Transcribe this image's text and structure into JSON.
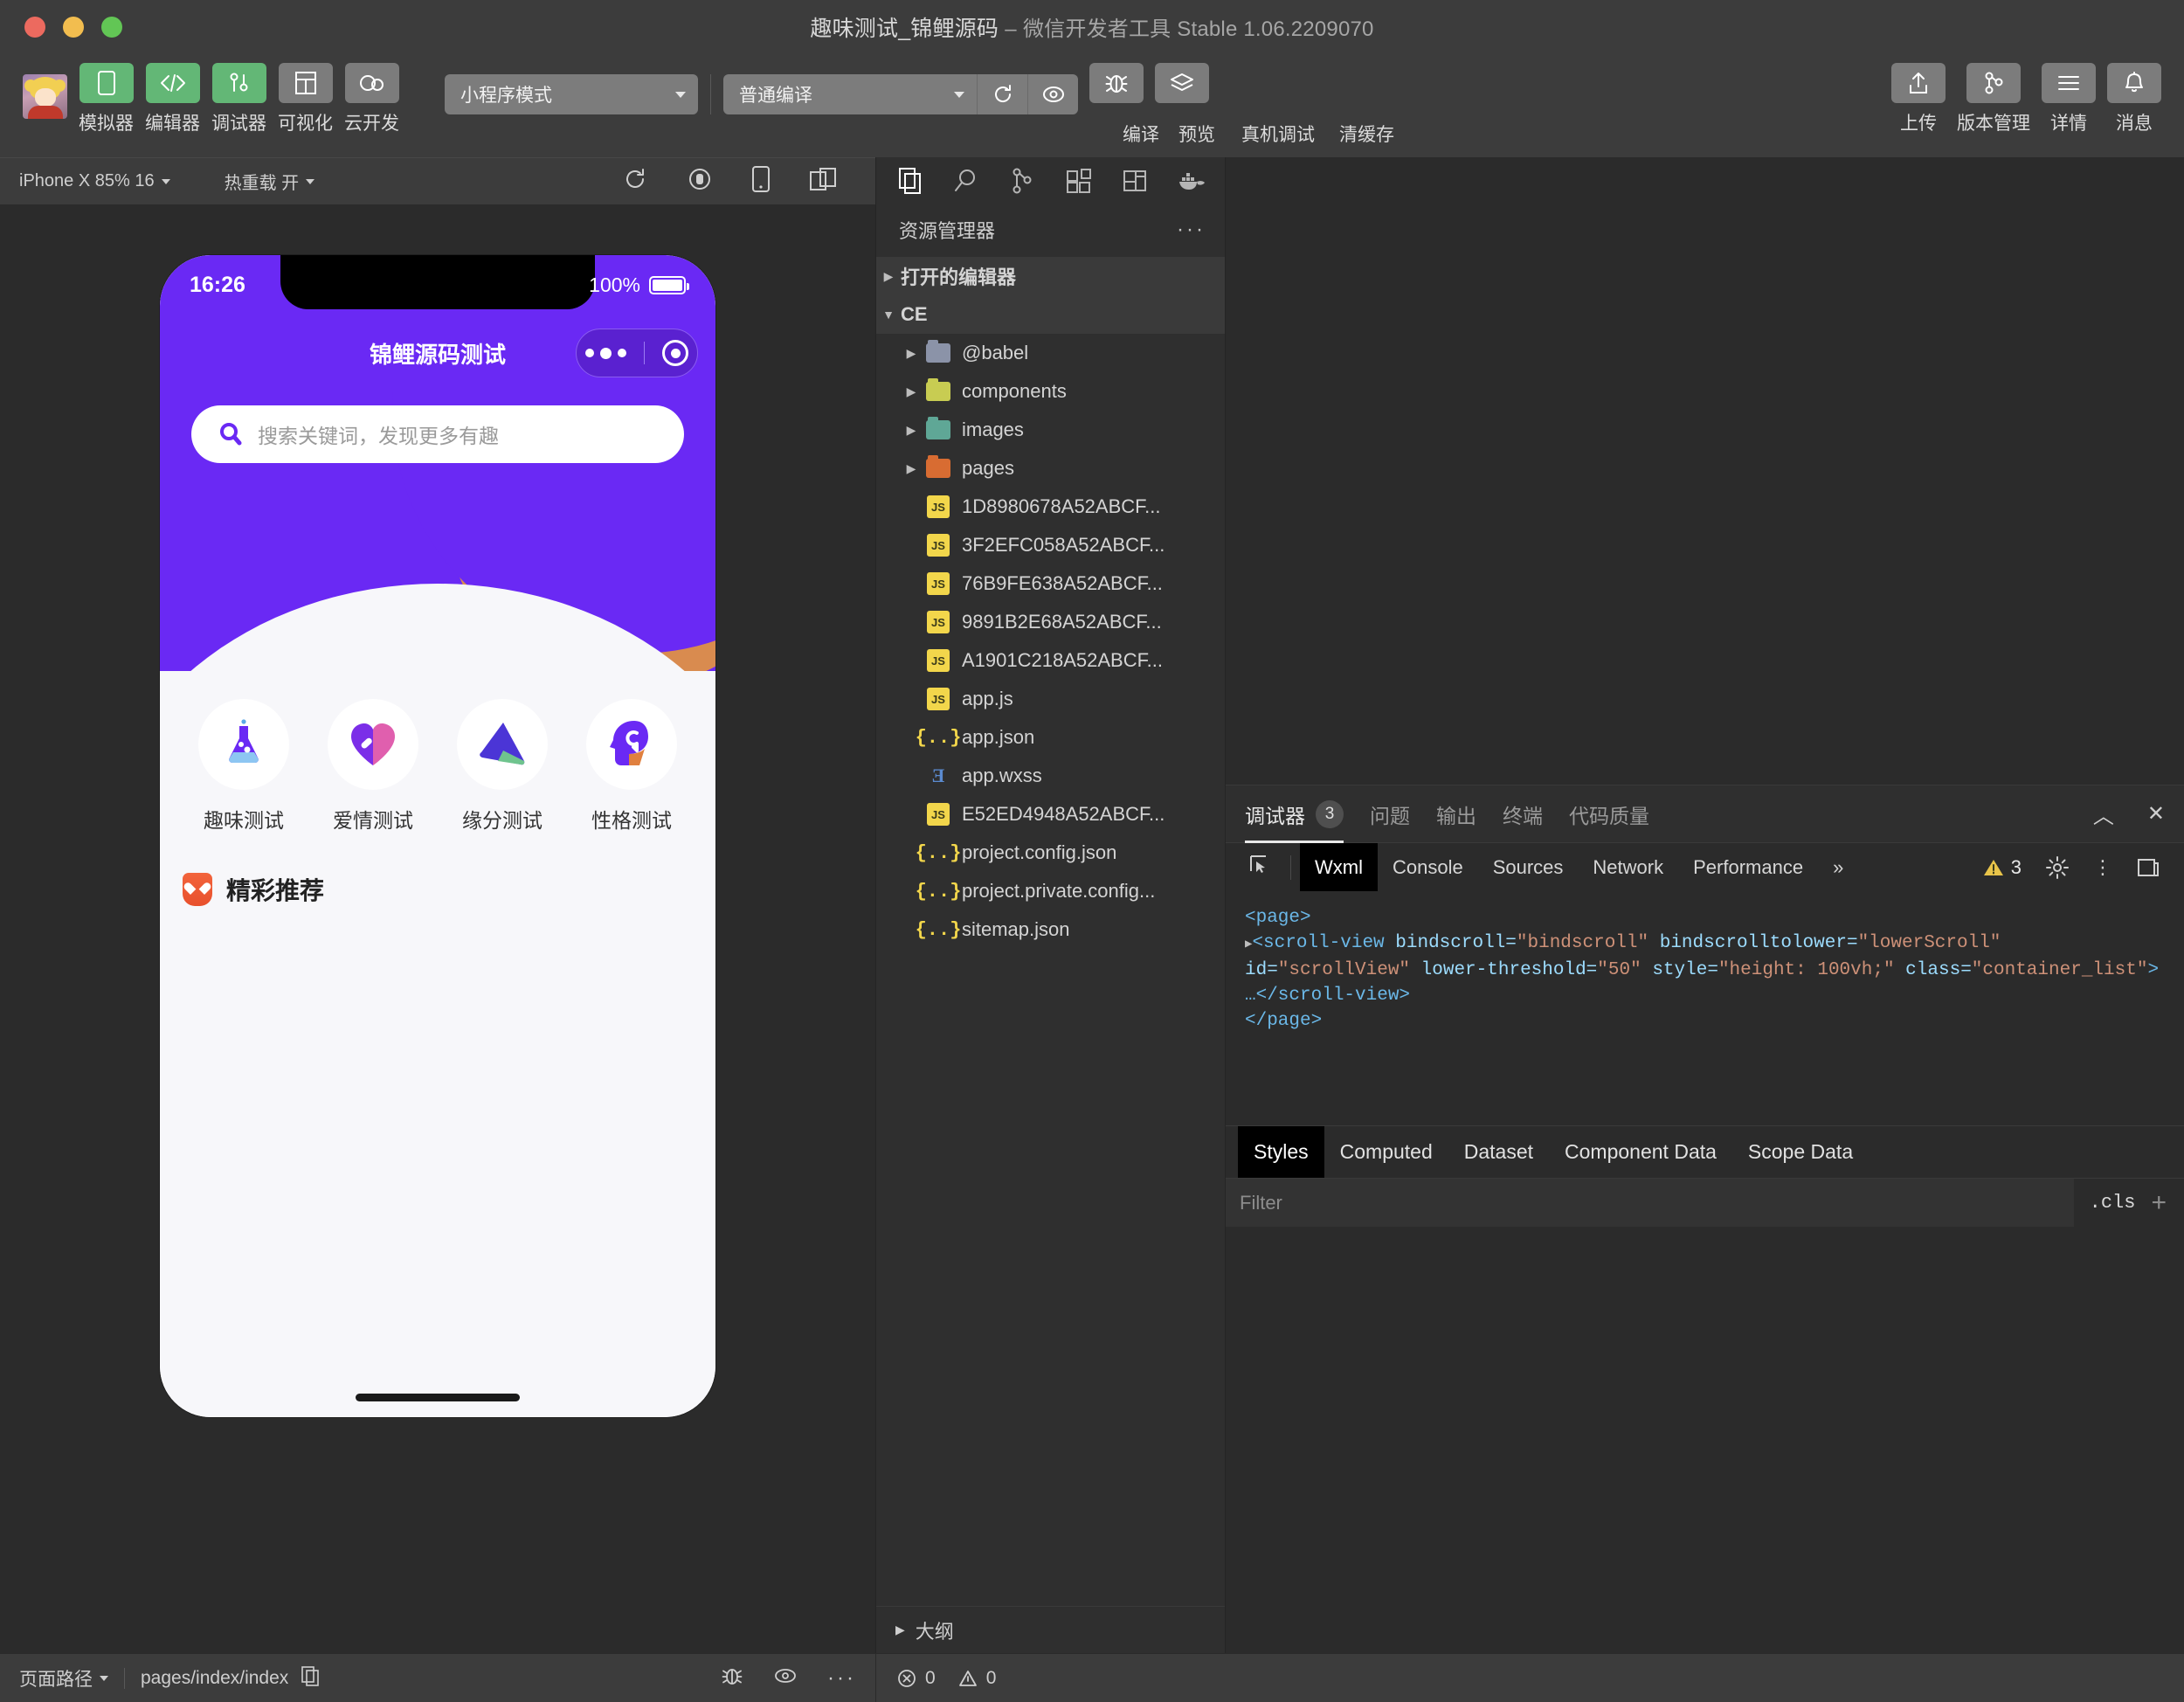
{
  "window": {
    "title_project": "趣味测试_锦鲤源码",
    "title_dash": "–",
    "title_app": "微信开发者工具 Stable 1.06.2209070"
  },
  "toolbar": {
    "buttons": [
      {
        "label": "模拟器",
        "icon": "simulator-icon",
        "style": "green"
      },
      {
        "label": "编辑器",
        "icon": "code-icon",
        "style": "green"
      },
      {
        "label": "调试器",
        "icon": "debugger-icon",
        "style": "green"
      },
      {
        "label": "可视化",
        "icon": "visual-icon",
        "style": "grey"
      },
      {
        "label": "云开发",
        "icon": "cloud-icon",
        "style": "grey"
      }
    ],
    "mode_select": "小程序模式",
    "compile_select": "普通编译",
    "compile_label": "编译",
    "preview_label": "预览",
    "device_debug_label": "真机调试",
    "clear_cache_label": "清缓存",
    "right_buttons": [
      {
        "label": "上传",
        "icon": "upload-icon"
      },
      {
        "label": "版本管理",
        "icon": "branch-icon"
      },
      {
        "label": "详情",
        "icon": "menu-icon"
      },
      {
        "label": "消息",
        "icon": "bell-icon"
      }
    ]
  },
  "simulator_bar": {
    "device": "iPhone X 85% 16",
    "hot_reload": "热重载 开",
    "icons": [
      "refresh-icon",
      "stop-record-icon",
      "phone-icon",
      "multi-window-icon"
    ]
  },
  "phone": {
    "status": {
      "time": "16:26",
      "battery": "100%"
    },
    "nav_title": "锦鲤源码测试",
    "search_placeholder": "搜索关键词，发现更多有趣",
    "categories": [
      {
        "label": "趣味测试",
        "icon": "flask-icon"
      },
      {
        "label": "爱情测试",
        "icon": "heart-icon"
      },
      {
        "label": "缘分测试",
        "icon": "arrow-icon"
      },
      {
        "label": "性格测试",
        "icon": "head-icon"
      }
    ],
    "section_title": "精彩推荐",
    "colors": {
      "primary": "#6a29f4",
      "accent": "#d98b4f",
      "bg": "#f7f7fa"
    }
  },
  "explorer": {
    "icon_bar": [
      "files-icon",
      "search-icon",
      "source-control-icon",
      "extensions-icon",
      "layout-icon",
      "docker-icon"
    ],
    "title": "资源管理器",
    "more": "···",
    "open_editors": "打开的编辑器",
    "project_root": "CE",
    "outline": "大纲",
    "items": [
      {
        "name": "@babel",
        "type": "folder",
        "color": "#8b93a8"
      },
      {
        "name": "components",
        "type": "folder",
        "color": "#c8cc52"
      },
      {
        "name": "images",
        "type": "folder",
        "color": "#5fa796"
      },
      {
        "name": "pages",
        "type": "folder",
        "color": "#d86c32"
      },
      {
        "name": "1D8980678A52ABCF...",
        "type": "js"
      },
      {
        "name": "3F2EFC058A52ABCF...",
        "type": "js"
      },
      {
        "name": "76B9FE638A52ABCF...",
        "type": "js"
      },
      {
        "name": "9891B2E68A52ABCF...",
        "type": "js"
      },
      {
        "name": "A1901C218A52ABCF...",
        "type": "js"
      },
      {
        "name": "app.js",
        "type": "js"
      },
      {
        "name": "app.json",
        "type": "json"
      },
      {
        "name": "app.wxss",
        "type": "wxss"
      },
      {
        "name": "E52ED4948A52ABCF...",
        "type": "js"
      },
      {
        "name": "project.config.json",
        "type": "json"
      },
      {
        "name": "project.private.config...",
        "type": "json"
      },
      {
        "name": "sitemap.json",
        "type": "json"
      }
    ]
  },
  "debugger": {
    "panel_tabs": [
      {
        "label": "调试器",
        "badge": "3",
        "active": true
      },
      {
        "label": "问题",
        "badge": "",
        "active": false
      },
      {
        "label": "输出",
        "badge": "",
        "active": false
      },
      {
        "label": "终端",
        "badge": "",
        "active": false
      },
      {
        "label": "代码质量",
        "badge": "",
        "active": false
      }
    ],
    "collapse_icon": "chevron-up-icon",
    "close_icon": "close-icon",
    "devtool_tabs": [
      {
        "label": "Wxml",
        "active": true
      },
      {
        "label": "Console",
        "active": false
      },
      {
        "label": "Sources",
        "active": false
      },
      {
        "label": "Network",
        "active": false
      },
      {
        "label": "Performance",
        "active": false
      }
    ],
    "more_tabs": "»",
    "warning_count": "3",
    "code": {
      "line1_open": "<page>",
      "line2_tag": "<scroll-view ",
      "attr1": "bindscroll=",
      "val1": "\"bindscroll\"",
      "attr2": " bindscrolltolower=",
      "val2": "\"lowerScroll\"",
      "attr3": " id=",
      "val3": "\"scrollView\"",
      "attr4": " lower-threshold=",
      "val4": "\"50\"",
      "attr5": " style=",
      "val5": "\"height: 100vh;\"",
      "attr6": " class=",
      "val6": "\"container_list\"",
      "gt": ">",
      "line3": "…</scroll-view>",
      "line4": "</page>"
    },
    "style_tabs": [
      {
        "label": "Styles",
        "active": true
      },
      {
        "label": "Computed",
        "active": false
      },
      {
        "label": "Dataset",
        "active": false
      },
      {
        "label": "Component Data",
        "active": false
      },
      {
        "label": "Scope Data",
        "active": false
      }
    ],
    "filter_placeholder": "Filter",
    "cls_label": ".cls",
    "plus_label": "+"
  },
  "statusbar": {
    "page_path_label": "页面路径",
    "page_path": "pages/index/index",
    "copy_icon": "copy-icon",
    "icons": [
      "bug-icon",
      "eye-icon",
      "ellipsis-icon"
    ],
    "error_count": "0",
    "warning_count": "0"
  }
}
